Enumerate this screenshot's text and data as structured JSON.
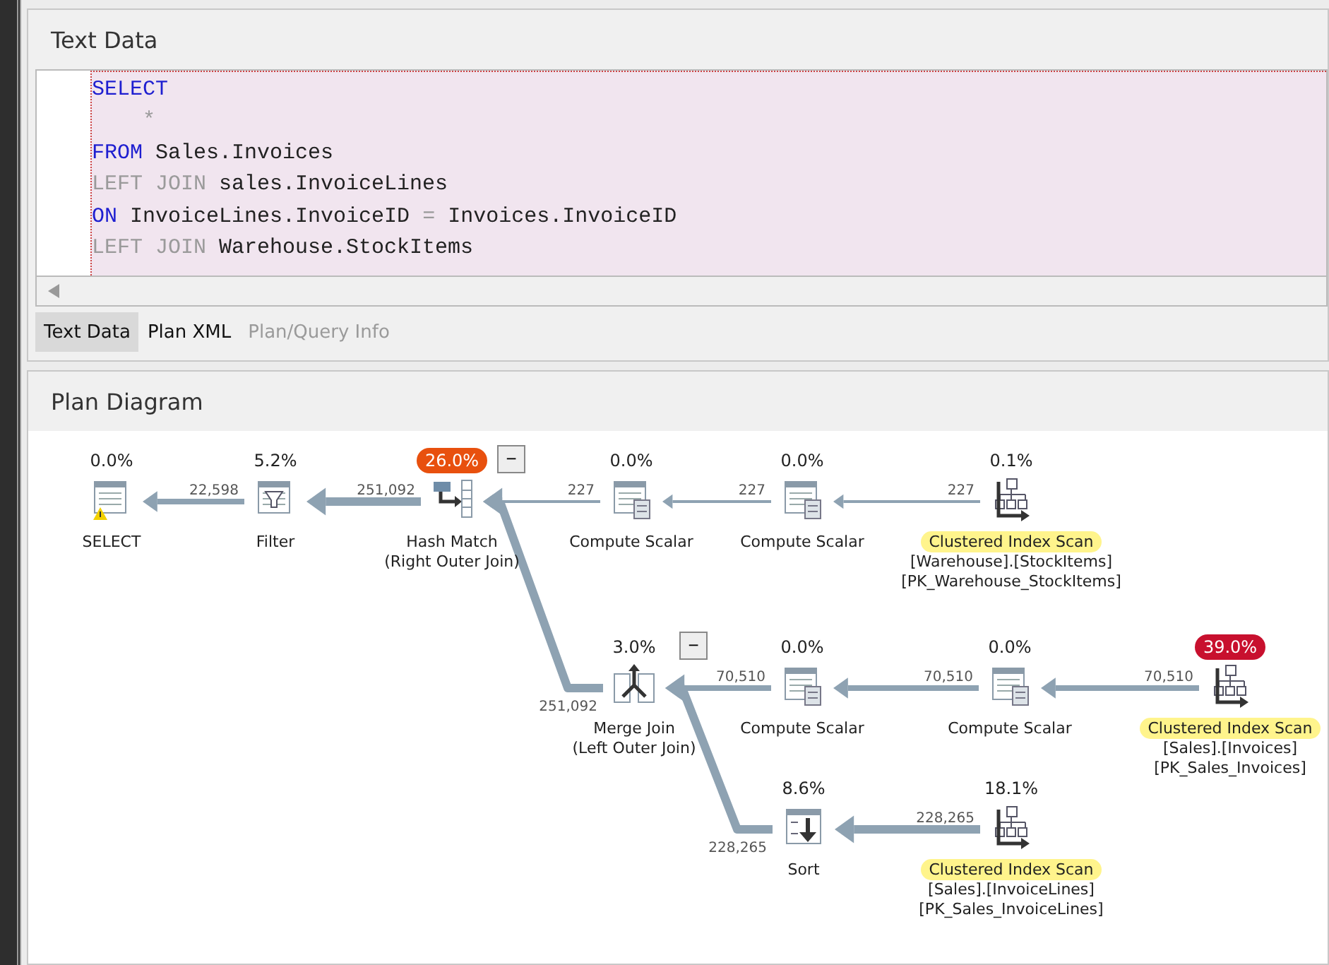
{
  "text_panel": {
    "title": "Text Data",
    "code_lines": [
      [
        {
          "kind": "keyword",
          "text": "SELECT"
        }
      ],
      [
        {
          "kind": "muted",
          "text": "    *"
        }
      ],
      [
        {
          "kind": "keyword",
          "text": "FROM"
        },
        {
          "kind": "plain",
          "text": " Sales.Invoices"
        }
      ],
      [
        {
          "kind": "muted",
          "text": "LEFT JOIN"
        },
        {
          "kind": "plain",
          "text": " sales.InvoiceLines"
        }
      ],
      [
        {
          "kind": "keyword",
          "text": "ON"
        },
        {
          "kind": "plain",
          "text": " InvoiceLines.InvoiceID "
        },
        {
          "kind": "muted",
          "text": "="
        },
        {
          "kind": "plain",
          "text": " Invoices.InvoiceID"
        }
      ],
      [
        {
          "kind": "muted",
          "text": "LEFT JOIN"
        },
        {
          "kind": "plain",
          "text": " Warehouse.StockItems"
        }
      ]
    ],
    "tabs": [
      {
        "label": "Text Data",
        "selected": true,
        "disabled": false
      },
      {
        "label": "Plan XML",
        "selected": false,
        "disabled": false
      },
      {
        "label": "Plan/Query Info",
        "selected": false,
        "disabled": true
      }
    ]
  },
  "plan_panel": {
    "title": "Plan Diagram",
    "nodes": [
      {
        "kind": "select",
        "cost": "0.0%",
        "label": "SELECT",
        "warning": true,
        "highlighted": false
      },
      {
        "kind": "filter",
        "cost": "5.2%",
        "label": "Filter",
        "warning": false,
        "highlighted": false
      },
      {
        "kind": "hash",
        "cost": "26.0%",
        "color": "#e8500e",
        "toggle": "−",
        "label": "Hash Match",
        "warning": false,
        "highlighted": false,
        "details": [
          "(Right Outer Join)"
        ]
      },
      {
        "kind": "compute",
        "cost": "0.0%",
        "label": "Compute Scalar",
        "warning": false,
        "highlighted": false
      },
      {
        "kind": "compute",
        "cost": "0.0%",
        "label": "Compute Scalar",
        "warning": false,
        "highlighted": false
      },
      {
        "kind": "scan",
        "cost": "0.1%",
        "label": "Clustered Index Scan",
        "warning": false,
        "highlighted": true,
        "details": [
          "[Warehouse].[StockItems]",
          "[PK_Warehouse_StockItems]"
        ]
      },
      {
        "kind": "merge",
        "cost": "3.0%",
        "toggle": "−",
        "label": "Merge Join",
        "warning": false,
        "highlighted": false,
        "details": [
          "(Left Outer Join)"
        ]
      },
      {
        "kind": "compute",
        "cost": "0.0%",
        "label": "Compute Scalar",
        "warning": false,
        "highlighted": false
      },
      {
        "kind": "compute",
        "cost": "0.0%",
        "label": "Compute Scalar",
        "warning": false,
        "highlighted": false
      },
      {
        "kind": "scan",
        "cost": "39.0%",
        "color": "#c8102e",
        "label": "Clustered Index Scan",
        "warning": false,
        "highlighted": true,
        "details": [
          "[Sales].[Invoices]",
          "[PK_Sales_Invoices]"
        ]
      },
      {
        "kind": "sort",
        "cost": "8.6%",
        "label": "Sort",
        "warning": false,
        "highlighted": false
      },
      {
        "kind": "scan",
        "cost": "18.1%",
        "label": "Clustered Index Scan",
        "warning": false,
        "highlighted": true,
        "details": [
          "[Sales].[InvoiceLines]",
          "[PK_Sales_InvoiceLines]"
        ]
      }
    ],
    "edges": [
      {
        "rows": "22,598",
        "kind": "medium"
      },
      {
        "rows": "251,092",
        "kind": "thick"
      },
      {
        "rows": "227",
        "kind": "thin"
      },
      {
        "rows": "227",
        "kind": "thin"
      },
      {
        "rows": "227",
        "kind": "thin"
      },
      {
        "rows": "251,092",
        "kind": "thick"
      },
      {
        "rows": "70,510",
        "kind": "medium"
      },
      {
        "rows": "70,510",
        "kind": "medium"
      },
      {
        "rows": "70,510",
        "kind": "medium"
      },
      {
        "rows": "228,265",
        "kind": "thick"
      },
      {
        "rows": "228,265",
        "kind": "thick"
      }
    ]
  }
}
